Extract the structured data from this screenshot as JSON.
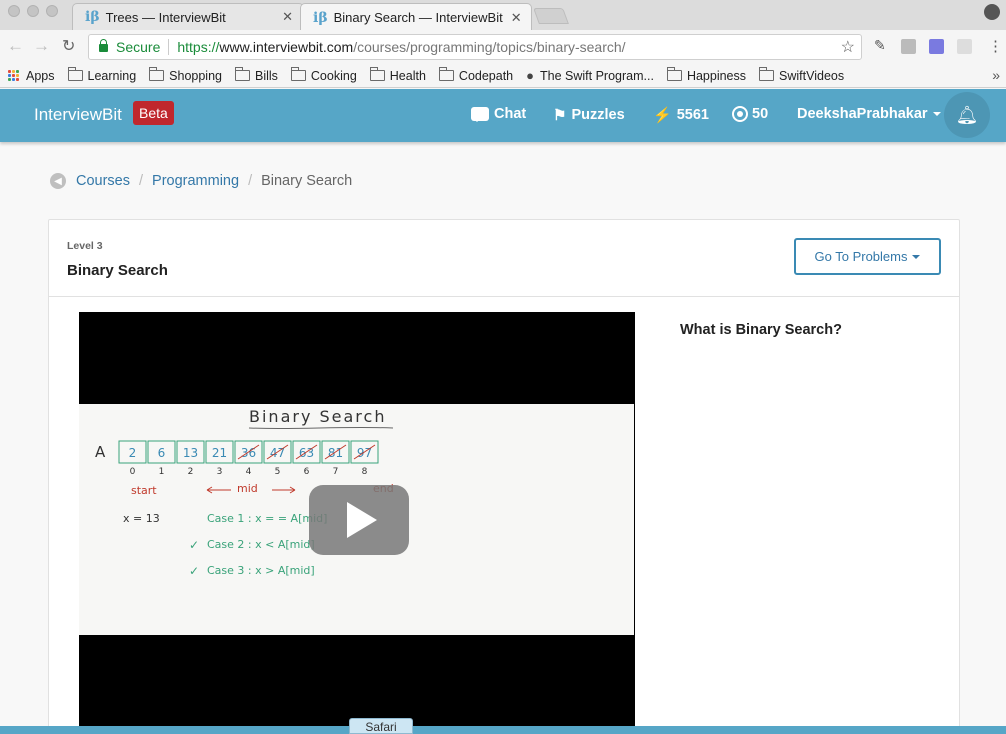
{
  "browser": {
    "tabs": [
      {
        "favicon": "iβ",
        "title": "Trees — InterviewBit",
        "active": false
      },
      {
        "favicon": "iβ",
        "title": "Binary Search — InterviewBit",
        "active": true
      }
    ],
    "omnibox": {
      "secure_label": "Secure",
      "url_scheme": "https://",
      "url_host": "www.interviewbit.com",
      "url_path": "/courses/programming/topics/binary-search/"
    },
    "bookmarks": [
      {
        "label": "Apps",
        "icon": "apps-icon"
      },
      {
        "label": "Learning",
        "icon": "folder-icon"
      },
      {
        "label": "Shopping",
        "icon": "folder-icon"
      },
      {
        "label": "Bills",
        "icon": "folder-icon"
      },
      {
        "label": "Cooking",
        "icon": "folder-icon"
      },
      {
        "label": "Health",
        "icon": "folder-icon"
      },
      {
        "label": "Codepath",
        "icon": "folder-icon"
      },
      {
        "label": "The Swift Program...",
        "icon": "apple-icon"
      },
      {
        "label": "Happiness",
        "icon": "folder-icon"
      },
      {
        "label": "SwiftVideos",
        "icon": "folder-icon"
      }
    ],
    "bookmarks_more": "»"
  },
  "site": {
    "logo": "InterviewBit",
    "badge": "Beta",
    "nav": {
      "chat": "Chat",
      "puzzles": "Puzzles",
      "score": "5561",
      "streak": "50",
      "user": "DeekshaPrabhakar"
    },
    "accent_color": "#56a6c7"
  },
  "breadcrumb": {
    "items": [
      "Courses",
      "Programming"
    ],
    "current": "Binary Search",
    "separator": "/"
  },
  "topic": {
    "level": "Level 3",
    "title": "Binary Search",
    "goto_button": "Go To Problems",
    "question": "What is Binary Search?"
  },
  "video": {
    "slide": {
      "heading": "Binary Search",
      "array_label": "A",
      "cells": [
        "2",
        "6",
        "13",
        "21",
        "36",
        "47",
        "63",
        "81",
        "97"
      ],
      "indices": [
        "0",
        "1",
        "2",
        "3",
        "4",
        "5",
        "6",
        "7",
        "8"
      ],
      "start_label": "start",
      "mid_label": "mid",
      "end_label": "end",
      "target": "x = 13",
      "cases": [
        "Case 1 :   x = = A[mid]",
        "Case 2 :   x < A[mid]",
        "Case 3 :   x > A[mid]"
      ]
    }
  },
  "dock": {
    "label": "Safari"
  }
}
